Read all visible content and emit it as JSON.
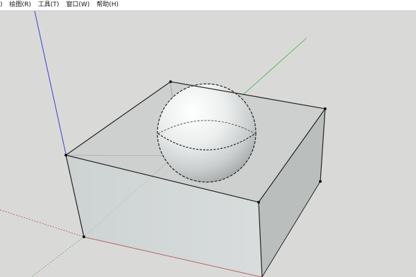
{
  "menubar": {
    "items": [
      {
        "label": ")"
      },
      {
        "label": "绘图(R)"
      },
      {
        "label": "工具(T)"
      },
      {
        "label": "窗口(W)"
      },
      {
        "label": "帮助(H)"
      }
    ]
  },
  "viewport": {
    "background": "#d9dad8",
    "axis_colors": {
      "blue": "#3b3ccc",
      "green": "#4aa84a",
      "red": "#b03030"
    },
    "objects": [
      "box",
      "sphere"
    ]
  }
}
